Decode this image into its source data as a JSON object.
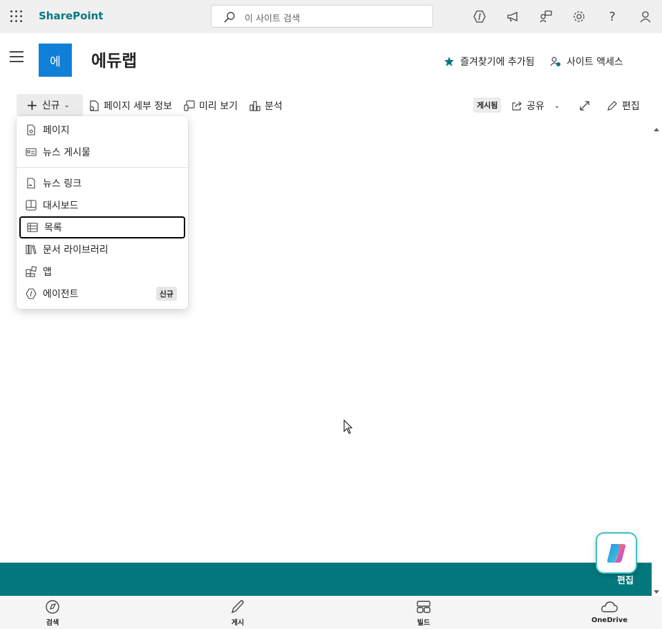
{
  "suite": {
    "brand": "SharePoint",
    "search_placeholder": "이 사이트 검색"
  },
  "site": {
    "logo_text": "에",
    "title": "에듀랩",
    "favorite_label": "즐겨찾기에 추가됨",
    "access_label": "사이트 액세스"
  },
  "commands": {
    "new_label": "신규",
    "page_details": "페이지 세부 정보",
    "preview": "미리 보기",
    "analytics": "분석",
    "published_badge": "게시됨",
    "share": "공유",
    "edit": "편집"
  },
  "new_menu": {
    "items": [
      {
        "label": "페이지"
      },
      {
        "label": "뉴스 게시물"
      },
      {
        "label": "뉴스 링크"
      },
      {
        "label": "대시보드"
      },
      {
        "label": "목록"
      },
      {
        "label": "문서 라이브러리"
      },
      {
        "label": "앱"
      },
      {
        "label": "에이전트"
      }
    ],
    "new_tag": "신규"
  },
  "fab": {
    "label": "편집"
  },
  "appbar": {
    "items": [
      {
        "label": "검색"
      },
      {
        "label": "게시"
      },
      {
        "label": "빌드"
      },
      {
        "label": "OneDrive"
      }
    ]
  },
  "colors": {
    "brand": "#03787c",
    "site_logo": "#0f7fd7",
    "accent_cyan": "#39c1c6"
  }
}
